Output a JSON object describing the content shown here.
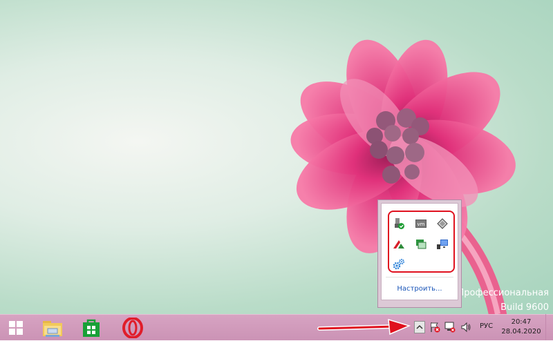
{
  "desktop": {
    "watermark_line1": "Профессиональная",
    "watermark_line2": "Build 9600"
  },
  "tray_popup": {
    "customize_label": "Настроить...",
    "icons": [
      "usb-safe-remove-icon",
      "vmware-icon",
      "stylus-icon",
      "delta-icon",
      "virtual-display-icon",
      "network-monitor-icon",
      "settings-gears-icon"
    ]
  },
  "taskbar": {
    "pinned": [
      "start-button",
      "file-explorer",
      "windows-store",
      "opera-browser"
    ],
    "language": "РУС",
    "time": "20:47",
    "date": "28.04.2020"
  },
  "colors": {
    "taskbar": "#cf98ba",
    "highlight": "#e0101e",
    "link": "#1a55b8",
    "arrow": "#e0101e"
  }
}
